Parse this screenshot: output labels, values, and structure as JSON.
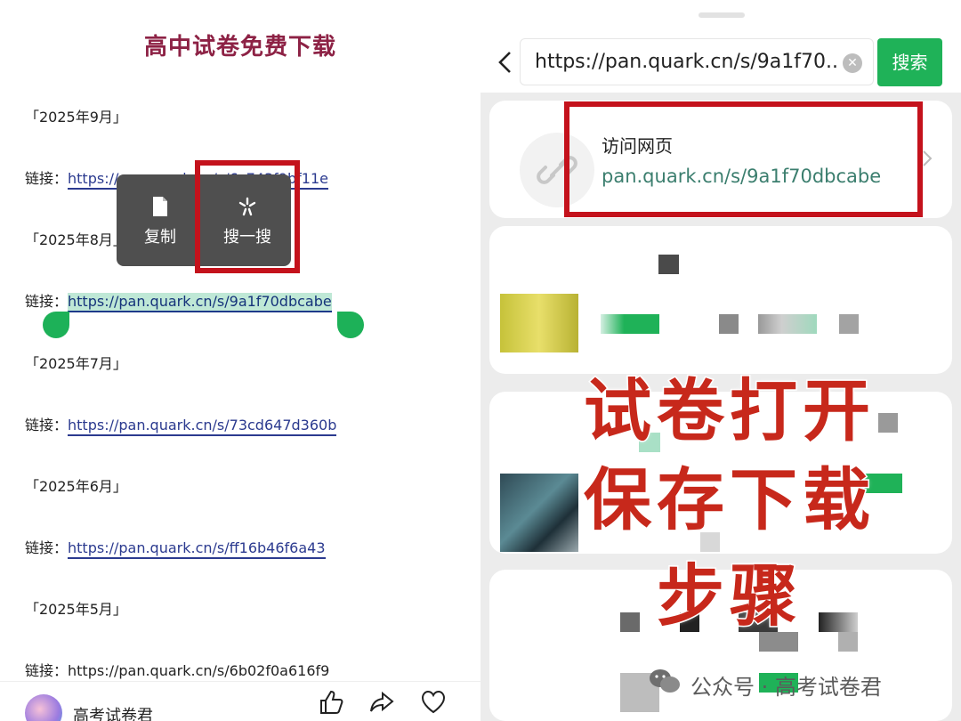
{
  "left": {
    "title": "高中试卷免费下载",
    "entries": [
      {
        "month": "「2025年9月」",
        "label": "链接：",
        "url": "https://pan.quark.cn/s/6c743f9bf11e"
      },
      {
        "month": "「2025年8月」",
        "label": "链接：",
        "url": "https://pan.quark.cn/s/9a1f70dbcabe"
      },
      {
        "month": "「2025年7月」",
        "label": "链接：",
        "url": "https://pan.quark.cn/s/73cd647d360b"
      },
      {
        "month": "「2025年6月」",
        "label": "链接：",
        "url": "https://pan.quark.cn/s/ff16b46f6a43"
      },
      {
        "month": "「2025年5月」",
        "label": "链接：",
        "url": "https://pan.quark.cn/s/6b02f0a616f9"
      }
    ],
    "popup": {
      "copy_label": "复制",
      "search_label": "搜一搜"
    },
    "author": "高考试卷君"
  },
  "right": {
    "search": {
      "query": "https://pan.quark.cn/s/9a1f70...",
      "button_label": "搜索"
    },
    "visit": {
      "title": "访问网页",
      "url": "pan.quark.cn/s/9a1f70dbcabe"
    },
    "overlay": {
      "line1": "试卷打开",
      "line2": "保存下载",
      "line3": "步骤"
    },
    "watermark": "公众号 · 高考试卷君"
  },
  "colors": {
    "title": "#8d2245",
    "link": "#2b3a8f",
    "selection": "#bfe8d6",
    "accent_green": "#1fb258",
    "highlight_red": "#c4121c",
    "overlay_red": "#c7281b"
  },
  "icons": [
    "copy-icon",
    "sparkle-search-icon",
    "back-chevron-icon",
    "clear-icon",
    "link-icon",
    "chevron-right-icon",
    "like-icon",
    "share-icon",
    "heart-icon",
    "wechat-icon"
  ]
}
